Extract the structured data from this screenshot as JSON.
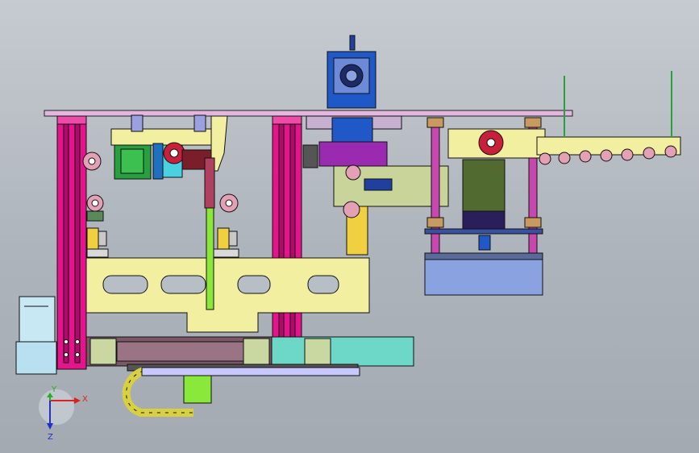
{
  "viewport": {
    "background_top": "#c6cbd1",
    "background_bottom": "#a3aab2"
  },
  "triad": {
    "x_label": "X",
    "y_label": "Y",
    "z_label": "Z",
    "x_color": "#e02020",
    "y_color": "#20b020",
    "z_color": "#2030d0"
  },
  "parts": {
    "top_plate_color": "#e3b6e0",
    "column_color": "#e6148c",
    "frame_color": "#f2f0a0",
    "servo_motor_color": "#2058c8",
    "cylinder_color": "#8aa2e0",
    "linear_guide_color": "#6ed8c8",
    "drag_chain_color": "#d8d040",
    "gripper_arm_color": "#8ae83a",
    "pulley_color": "#c8203a"
  }
}
